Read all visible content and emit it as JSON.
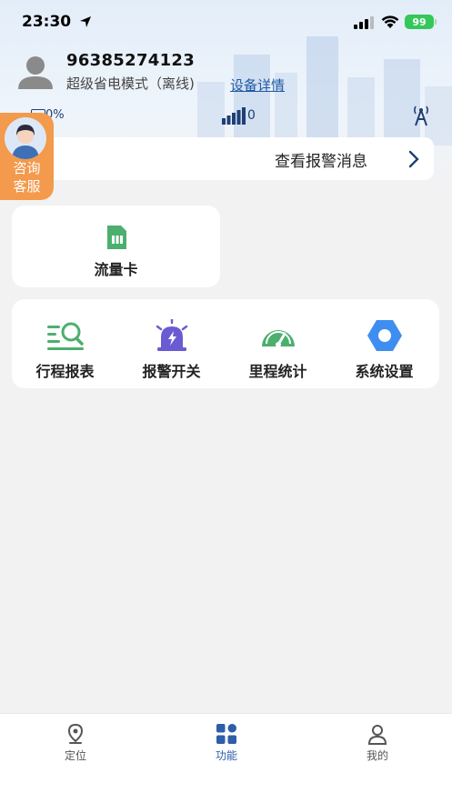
{
  "status_bar": {
    "time": "23:30",
    "battery": "99"
  },
  "device": {
    "id": "96385274123",
    "mode": "超级省电模式（离线)",
    "detail_link": "设备详情",
    "battery_pct": "0%",
    "signal_value": "0"
  },
  "customer_service": {
    "line1": "咨询",
    "line2": "客服"
  },
  "alarm": {
    "label": "查看报警消息"
  },
  "sim_card": {
    "label": "流量卡",
    "icon": "sim-card-icon"
  },
  "functions": [
    {
      "label": "行程报表",
      "icon": "trip-report-icon"
    },
    {
      "label": "报警开关",
      "icon": "alarm-switch-icon"
    },
    {
      "label": "里程统计",
      "icon": "speedometer-icon"
    },
    {
      "label": "系统设置",
      "icon": "settings-icon"
    }
  ],
  "tabs": [
    {
      "label": "定位",
      "icon": "location-pin-icon"
    },
    {
      "label": "功能",
      "icon": "grid-apps-icon",
      "active": true
    },
    {
      "label": "我的",
      "icon": "user-icon"
    }
  ],
  "colors": {
    "accent": "#2e5ea8",
    "orange": "#f39a4c",
    "green": "#4caf6e",
    "purple": "#6b5bd2",
    "blue": "#3d8ef0"
  }
}
